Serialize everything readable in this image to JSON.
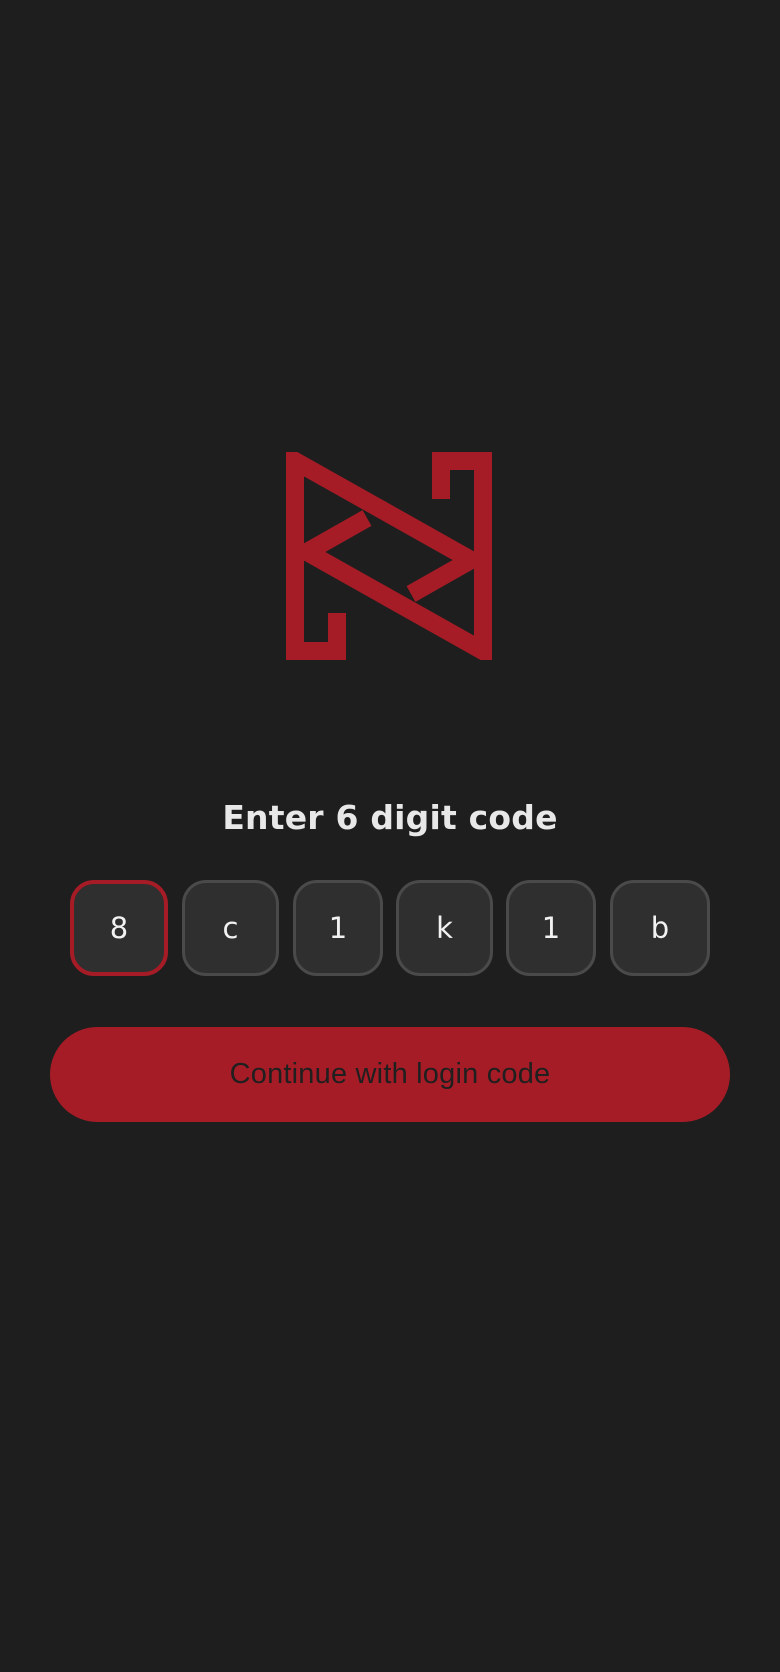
{
  "logo": {
    "icon": "n-brand-logo-icon",
    "color": "#a61c26"
  },
  "title": "Enter 6 digit code",
  "code": {
    "digits": [
      "8",
      "c",
      "1",
      "k",
      "1",
      "b"
    ],
    "focused_index": 0
  },
  "continue_label": "Continue with login code",
  "colors": {
    "background": "#1e1e1e",
    "accent": "#a61c26",
    "box_fill": "#2f2f2f",
    "box_border": "#4a4a4a"
  }
}
